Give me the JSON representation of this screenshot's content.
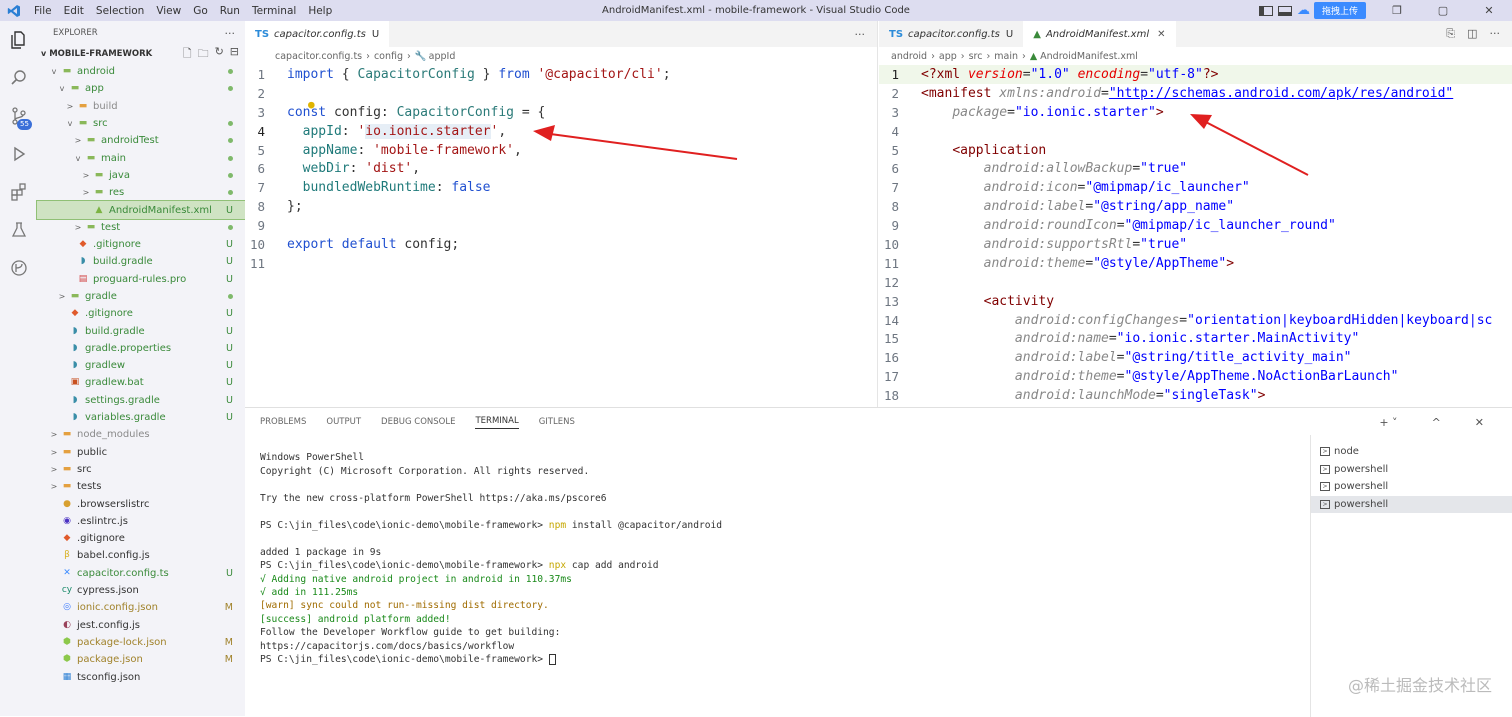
{
  "app": {
    "title": "AndroidManifest.xml - mobile-framework - Visual Studio Code",
    "menu": [
      "File",
      "Edit",
      "Selection",
      "View",
      "Go",
      "Run",
      "Terminal",
      "Help"
    ],
    "upload_label": "拖拽上传",
    "scm_badge": "55"
  },
  "explorer": {
    "header": "EXPLORER",
    "root": "MOBILE-FRAMEWORK",
    "items": [
      {
        "label": "android",
        "depth": 1,
        "chev": "v",
        "icon": "folder-icon",
        "color": "#3a8a3a",
        "status": "dot"
      },
      {
        "label": "app",
        "depth": 2,
        "chev": "v",
        "icon": "folder-icon",
        "color": "#3a8a3a",
        "status": "dot"
      },
      {
        "label": "build",
        "depth": 3,
        "chev": ">",
        "icon": "folder-icon",
        "color": "#8a8a8a",
        "status": ""
      },
      {
        "label": "src",
        "depth": 3,
        "chev": "v",
        "icon": "folder-icon",
        "color": "#3a8a3a",
        "status": "dot"
      },
      {
        "label": "androidTest",
        "depth": 4,
        "chev": ">",
        "icon": "folder-icon",
        "color": "#3a8a3a",
        "status": "dot"
      },
      {
        "label": "main",
        "depth": 4,
        "chev": "v",
        "icon": "folder-icon",
        "color": "#3a8a3a",
        "status": "dot"
      },
      {
        "label": "java",
        "depth": 5,
        "chev": ">",
        "icon": "folder-icon",
        "color": "#3a8a3a",
        "status": "dot"
      },
      {
        "label": "res",
        "depth": 5,
        "chev": ">",
        "icon": "folder-icon",
        "color": "#3a8a3a",
        "status": "dot"
      },
      {
        "label": "AndroidManifest.xml",
        "depth": 5,
        "chev": "",
        "icon": "android-icon",
        "color": "#3a8a3a",
        "status": "U",
        "selected": true
      },
      {
        "label": "test",
        "depth": 4,
        "chev": ">",
        "icon": "folder-icon",
        "color": "#3a8a3a",
        "status": "dot"
      },
      {
        "label": ".gitignore",
        "depth": 3,
        "chev": "",
        "icon": "git-icon",
        "color": "#3a8a3a",
        "status": "U"
      },
      {
        "label": "build.gradle",
        "depth": 3,
        "chev": "",
        "icon": "gradle-icon",
        "color": "#3a8a3a",
        "status": "U"
      },
      {
        "label": "proguard-rules.pro",
        "depth": 3,
        "chev": "",
        "icon": "file-icon",
        "color": "#3a8a3a",
        "status": "U"
      },
      {
        "label": "gradle",
        "depth": 2,
        "chev": ">",
        "icon": "folder-icon",
        "color": "#3a8a3a",
        "status": "dot"
      },
      {
        "label": ".gitignore",
        "depth": 2,
        "chev": "",
        "icon": "git-icon",
        "color": "#3a8a3a",
        "status": "U"
      },
      {
        "label": "build.gradle",
        "depth": 2,
        "chev": "",
        "icon": "gradle-icon",
        "color": "#3a8a3a",
        "status": "U"
      },
      {
        "label": "gradle.properties",
        "depth": 2,
        "chev": "",
        "icon": "gradle-icon",
        "color": "#3a8a3a",
        "status": "U"
      },
      {
        "label": "gradlew",
        "depth": 2,
        "chev": "",
        "icon": "gradle-icon",
        "color": "#3a8a3a",
        "status": "U"
      },
      {
        "label": "gradlew.bat",
        "depth": 2,
        "chev": "",
        "icon": "bat-icon",
        "color": "#3a8a3a",
        "status": "U"
      },
      {
        "label": "settings.gradle",
        "depth": 2,
        "chev": "",
        "icon": "gradle-icon",
        "color": "#3a8a3a",
        "status": "U"
      },
      {
        "label": "variables.gradle",
        "depth": 2,
        "chev": "",
        "icon": "gradle-icon",
        "color": "#3a8a3a",
        "status": "U"
      },
      {
        "label": "node_modules",
        "depth": 1,
        "chev": ">",
        "icon": "folder-icon",
        "color": "#8a8a8a",
        "status": ""
      },
      {
        "label": "public",
        "depth": 1,
        "chev": ">",
        "icon": "folder-icon",
        "color": "#333333",
        "status": ""
      },
      {
        "label": "src",
        "depth": 1,
        "chev": ">",
        "icon": "folder-icon",
        "color": "#333333",
        "status": ""
      },
      {
        "label": "tests",
        "depth": 1,
        "chev": ">",
        "icon": "folder-icon",
        "color": "#333333",
        "status": ""
      },
      {
        "label": ".browserslistrc",
        "depth": 1,
        "chev": "",
        "icon": "dot-file-icon",
        "color": "#333333",
        "status": ""
      },
      {
        "label": ".eslintrc.js",
        "depth": 1,
        "chev": "",
        "icon": "eslint-icon",
        "color": "#333333",
        "status": ""
      },
      {
        "label": ".gitignore",
        "depth": 1,
        "chev": "",
        "icon": "git-icon",
        "color": "#333333",
        "status": ""
      },
      {
        "label": "babel.config.js",
        "depth": 1,
        "chev": "",
        "icon": "babel-icon",
        "color": "#333333",
        "status": ""
      },
      {
        "label": "capacitor.config.ts",
        "depth": 1,
        "chev": "",
        "icon": "capacitor-icon",
        "color": "#3a8a3a",
        "status": "U"
      },
      {
        "label": "cypress.json",
        "depth": 1,
        "chev": "",
        "icon": "cypress-icon",
        "color": "#333333",
        "status": ""
      },
      {
        "label": "ionic.config.json",
        "depth": 1,
        "chev": "",
        "icon": "ionic-icon",
        "color": "#a0822a",
        "status": "M"
      },
      {
        "label": "jest.config.js",
        "depth": 1,
        "chev": "",
        "icon": "jest-icon",
        "color": "#333333",
        "status": ""
      },
      {
        "label": "package-lock.json",
        "depth": 1,
        "chev": "",
        "icon": "nodejs-icon",
        "color": "#a0822a",
        "status": "M"
      },
      {
        "label": "package.json",
        "depth": 1,
        "chev": "",
        "icon": "nodejs-icon",
        "color": "#a0822a",
        "status": "M"
      },
      {
        "label": "tsconfig.json",
        "depth": 1,
        "chev": "",
        "icon": "tsconfig-icon",
        "color": "#333333",
        "status": ""
      }
    ]
  },
  "editor_left": {
    "tab_label": "capacitor.config.ts",
    "tab_status": "U",
    "breadcrumb": [
      "capacitor.config.ts",
      "config",
      "appId"
    ],
    "line_numbers": [
      "1",
      "2",
      "3",
      "4",
      "5",
      "6",
      "7",
      "8",
      "9",
      "10",
      "11"
    ]
  },
  "editor_right": {
    "tabs": [
      {
        "label": "capacitor.config.ts",
        "status": "U"
      },
      {
        "label": "AndroidManifest.xml",
        "status": ""
      }
    ],
    "breadcrumb": [
      "android",
      "app",
      "src",
      "main",
      "AndroidManifest.xml"
    ],
    "line_numbers": [
      "1",
      "2",
      "3",
      "4",
      "5",
      "6",
      "7",
      "8",
      "9",
      "10",
      "11",
      "12",
      "13",
      "14",
      "15",
      "16",
      "17",
      "18"
    ]
  },
  "panel": {
    "tabs": [
      "PROBLEMS",
      "OUTPUT",
      "DEBUG CONSOLE",
      "TERMINAL",
      "GITLENS"
    ],
    "active_tab": "TERMINAL",
    "terminals": [
      "node",
      "powershell",
      "powershell",
      "powershell"
    ],
    "terminal_lines": [
      "Windows PowerShell",
      "Copyright (C) Microsoft Corporation. All rights reserved.",
      "",
      "Try the new cross-platform PowerShell https://aka.ms/pscore6",
      "",
      "PS C:\\jin_files\\code\\ionic-demo\\mobile-framework> ",
      "",
      "added 1 package in 9s",
      "PS C:\\jin_files\\code\\ionic-demo\\mobile-framework> ",
      "√ Adding native android project in android in 110.37ms",
      "√ add in 111.25ms",
      "[warn] sync could not run--missing dist directory.",
      "[success] android platform added!",
      "Follow the Developer Workflow guide to get building:",
      "https://capacitorjs.com/docs/basics/workflow",
      "PS C:\\jin_files\\code\\ionic-demo\\mobile-framework> "
    ],
    "cmd1": "npm",
    "cmd1_args": " install @capacitor/android",
    "cmd2": "npx",
    "cmd2_args": " cap add android"
  },
  "watermark": "@稀土掘金技术社区",
  "colors": {
    "accent": "#3b8bff",
    "selected_row": "#cfe3c3",
    "arrow": "#e02020"
  }
}
